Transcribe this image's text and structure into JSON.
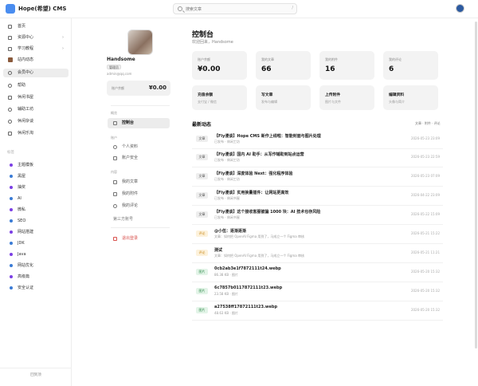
{
  "app": {
    "title": "Hope(希望) CMS"
  },
  "search": {
    "placeholder": "搜索文章",
    "shortcut": "/"
  },
  "sidebar": {
    "items": [
      {
        "label": "首页",
        "chevron": ""
      },
      {
        "label": "资源中心",
        "chevron": "›"
      },
      {
        "label": "学习教程",
        "chevron": "›"
      },
      {
        "label": "站内动态",
        "chevron": ""
      },
      {
        "label": "会员中心",
        "chevron": ""
      },
      {
        "label": "帮助",
        "chevron": ""
      },
      {
        "label": "休闲书屋",
        "chevron": ""
      },
      {
        "label": "辅助工坊",
        "chevron": ""
      },
      {
        "label": "休闲杂谈",
        "chevron": ""
      },
      {
        "label": "休闲乐淘",
        "chevron": ""
      }
    ],
    "tags_label": "标签",
    "tags": [
      {
        "label": "主题模板",
        "color": "#7b3fe4"
      },
      {
        "label": "黑屋",
        "color": "#3a7bd5"
      },
      {
        "label": "抽奖",
        "color": "#7b3fe4"
      },
      {
        "label": "AI",
        "color": "#3a7bd5"
      },
      {
        "label": "微私",
        "color": "#7b3fe4"
      },
      {
        "label": "SEO",
        "color": "#3a7bd5"
      },
      {
        "label": "网站搭建",
        "color": "#7b3fe4"
      },
      {
        "label": "JDK",
        "color": "#3a7bd5"
      },
      {
        "label": "Java",
        "color": "#7b3fe4"
      },
      {
        "label": "网站优化",
        "color": "#3a7bd5"
      },
      {
        "label": "高级篇",
        "color": "#7b3fe4"
      },
      {
        "label": "安全认证",
        "color": "#3a7bd5"
      }
    ],
    "footer": "回到顶"
  },
  "profile": {
    "name": "Handsome",
    "badge": "管理员",
    "email": "admin@qq.com",
    "balance_label": "账户余额",
    "balance_value": "¥0.00",
    "overview_label": "概览",
    "dashboard_label": "控制台",
    "account_label": "账户",
    "personal_info": "个人资料",
    "account_security": "账户安全",
    "content_label": "内容",
    "my_posts": "我的文章",
    "my_attachments": "我的附件",
    "my_comments": "我的评论",
    "third_party": "第三方账号",
    "logout": "退出登录"
  },
  "main": {
    "title": "控制台",
    "subtitle": "欢迎回来，Handsome",
    "stats": [
      {
        "label": "账户余额",
        "value": "¥0.00"
      },
      {
        "label": "我的文章",
        "value": "66"
      },
      {
        "label": "我的附件",
        "value": "16"
      },
      {
        "label": "我的评论",
        "value": "6"
      }
    ],
    "actions": [
      {
        "title": "充值余额",
        "desc": "支付宝 / 微信"
      },
      {
        "title": "写文章",
        "desc": "发布与编辑"
      },
      {
        "title": "上传附件",
        "desc": "图片与文件"
      },
      {
        "title": "编辑资料",
        "desc": "头像与简介"
      }
    ],
    "activity_title": "最新动态",
    "activity_filter": "文章 · 附件 · 评论",
    "activity": [
      {
        "tag": "文章",
        "tag_color": "#555",
        "tag_bg": "#eeeeee",
        "title": "【Fly漫谈】Hope CMS 新作上线啦：智能封面与图片处理",
        "meta": "已发布 · 休闲工坊",
        "time": "2026-05-23 23:09"
      },
      {
        "tag": "文章",
        "tag_color": "#555",
        "tag_bg": "#eeeeee",
        "title": "【Fly漫谈】国内 AI 助手：从写作辅助到站点运营",
        "meta": "已发布 · 休闲工坊",
        "time": "2026-05-23 22:59"
      },
      {
        "tag": "文章",
        "tag_color": "#555",
        "tag_bg": "#eeeeee",
        "title": "【Fly漫谈】深度体验 Next：强化程序体验",
        "meta": "已发布 · 休闲工坊",
        "time": "2026-05-23 07:09"
      },
      {
        "tag": "文章",
        "tag_color": "#555",
        "tag_bg": "#eeeeee",
        "title": "【Fly漫谈】实用换量插件：让网站更高效",
        "meta": "已发布 · 休闲书屋",
        "time": "2026-04-22 23:09"
      },
      {
        "tag": "文章",
        "tag_color": "#555",
        "tag_bg": "#eeeeee",
        "title": "【Fly漫谈】这个接收客服被骗 1000 块：AI 技术也存风险",
        "meta": "已发布 · 休闲书屋",
        "time": "2026-05-22 15:09"
      },
      {
        "tag": "评论",
        "tag_color": "#c98a1b",
        "tag_bg": "#fdf2dc",
        "title": "@小伍：逐渐逐渐",
        "meta": "文章：如何把 OpenAI Figma 用到了，马成立一个 Figma 审核",
        "time": "2026-05-21 15:22"
      },
      {
        "tag": "评论",
        "tag_color": "#c98a1b",
        "tag_bg": "#fdf2dc",
        "title": "测试",
        "meta": "文章：如何把 OpenAI Figma 用到了，马成立一个 Figma 审核",
        "time": "2026-05-21 11:21"
      },
      {
        "tag": "图片",
        "tag_color": "#2e8b4a",
        "tag_bg": "#e3f4e8",
        "title": "0cb2ab3e1f7872111t24.webp",
        "meta": "86.38 KB · 图片",
        "time": "2026-05-20 15:32"
      },
      {
        "tag": "图片",
        "tag_color": "#2e8b4a",
        "tag_bg": "#e3f4e8",
        "title": "6c7857b0117872111t23.webp",
        "meta": "23.58 KB · 图片",
        "time": "2026-05-20 15:32"
      },
      {
        "tag": "图片",
        "tag_color": "#2e8b4a",
        "tag_bg": "#e3f4e8",
        "title": "a27538ff17872111t23.webp",
        "meta": "48.63 KB · 图片",
        "time": "2026-05-20 15:32"
      }
    ]
  }
}
